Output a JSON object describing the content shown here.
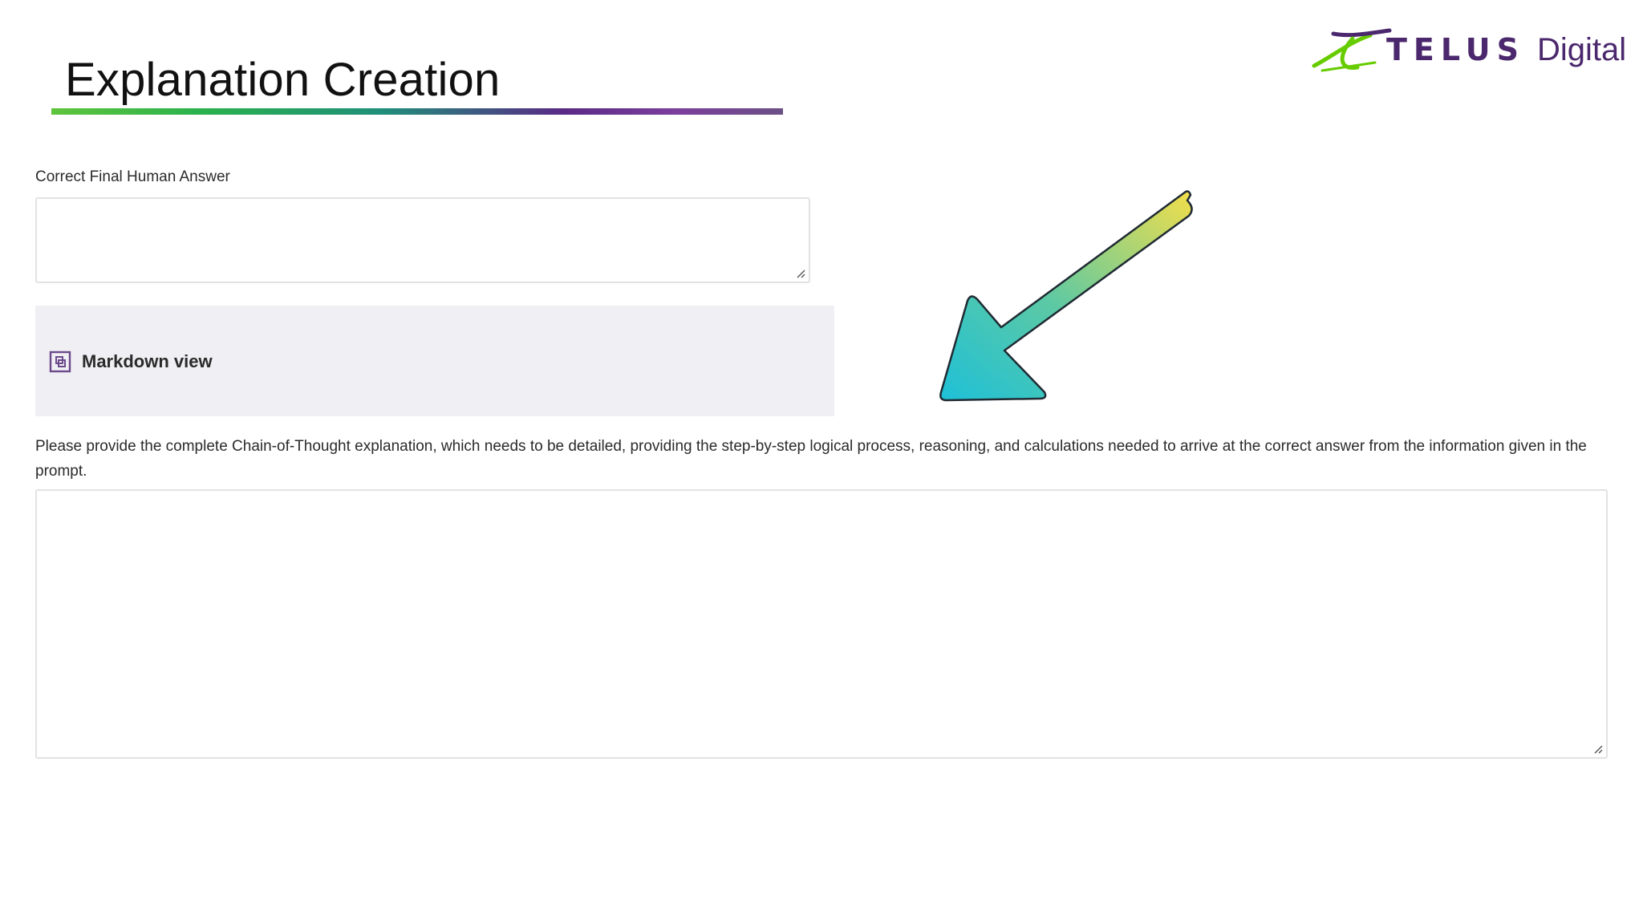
{
  "header": {
    "title": "Explanation Creation",
    "title_underline_colors": [
      "#5ec43c",
      "#2bb24c",
      "#1f8f7a",
      "#5a2a86",
      "#7b3e9c"
    ]
  },
  "logo": {
    "brand": "TELUS",
    "suffix": "Digital",
    "brand_color": "#4b286d",
    "mark_color": "#66cc00"
  },
  "form": {
    "answer_label": "Correct Final Human Answer",
    "answer_value": "",
    "markdown_toggle_label": "Markdown view",
    "markdown_icon": "markdown-view-icon",
    "explanation_instructions": "Please provide the complete Chain-of-Thought explanation, which needs to be detailed, providing the step-by-step logical process, reasoning, and calculations needed to arrive at the correct answer from the information given in the prompt.",
    "explanation_value": ""
  },
  "annotation": {
    "arrow_icon": "gradient-arrow-icon",
    "arrow_gradient": [
      "#1ec0d8",
      "#f2de4a"
    ]
  }
}
